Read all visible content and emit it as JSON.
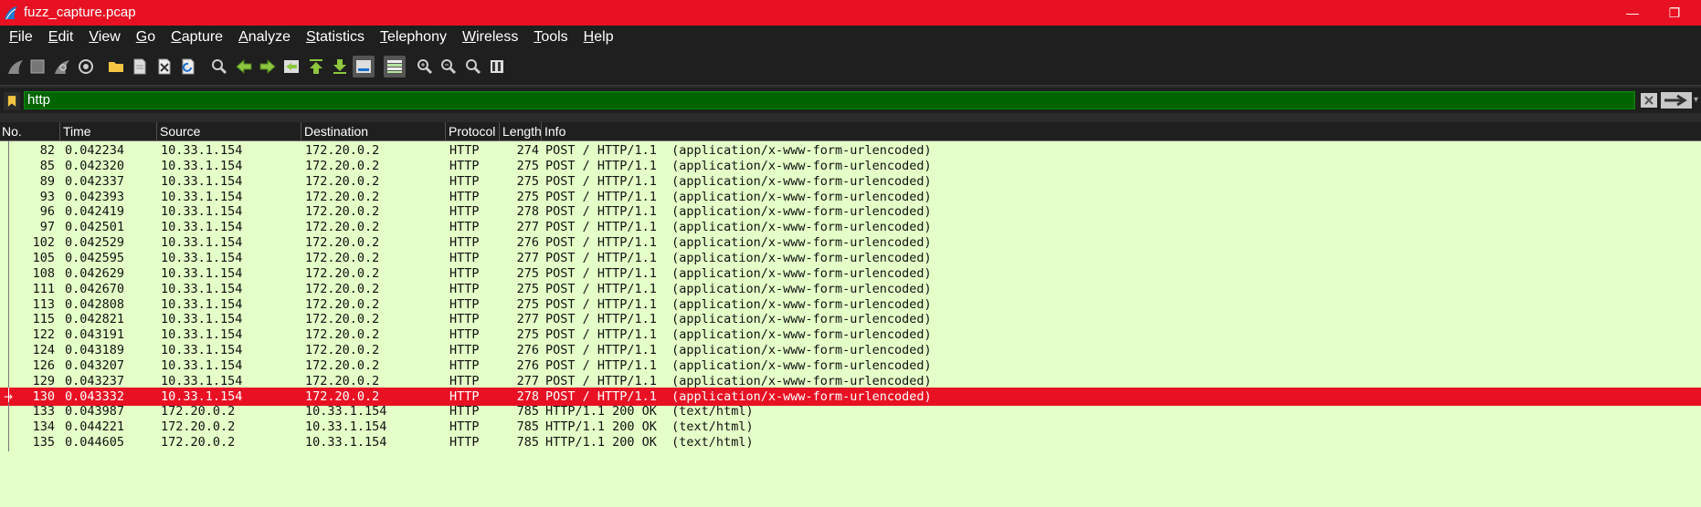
{
  "window": {
    "title": "fuzz_capture.pcap",
    "minimize_glyph": "—",
    "restore_glyph": "❐"
  },
  "menu": {
    "items": [
      {
        "label": "File",
        "key": "F",
        "rest": "ile"
      },
      {
        "label": "Edit",
        "key": "E",
        "rest": "dit"
      },
      {
        "label": "View",
        "key": "V",
        "rest": "iew"
      },
      {
        "label": "Go",
        "key": "G",
        "rest": "o"
      },
      {
        "label": "Capture",
        "key": "C",
        "rest": "apture"
      },
      {
        "label": "Analyze",
        "key": "A",
        "rest": "nalyze"
      },
      {
        "label": "Statistics",
        "key": "S",
        "rest": "tatistics"
      },
      {
        "label": "Telephony",
        "key": "T",
        "rest": "elephony"
      },
      {
        "label": "Wireless",
        "key": "W",
        "rest": "ireless"
      },
      {
        "label": "Tools",
        "key": "T",
        "rest": "ools"
      },
      {
        "label": "Help",
        "key": "H",
        "rest": "elp"
      }
    ]
  },
  "toolbar": {
    "icons": [
      "shark-fin-start-icon",
      "stop-square-icon",
      "restart-fin-icon",
      "capture-options-gear-icon",
      "open-folder-icon",
      "save-file-icon",
      "close-file-icon",
      "reload-icon",
      "find-packet-icon",
      "go-back-icon",
      "go-forward-icon",
      "go-to-packet-icon",
      "go-first-icon",
      "go-last-icon",
      "autoscroll-icon",
      "colorize-icon",
      "zoom-in-icon",
      "zoom-out-icon",
      "zoom-normal-icon",
      "resize-columns-icon"
    ]
  },
  "filter": {
    "value": "http",
    "bookmark_icon": "bookmark-icon",
    "clear_icon": "clear-filter-icon",
    "apply_icon": "apply-filter-arrow-icon",
    "background_color": "#006400"
  },
  "columns": [
    "No.",
    "Time",
    "Source",
    "Destination",
    "Protocol",
    "Length",
    "Info"
  ],
  "packets": [
    {
      "no": "82",
      "time": "0.042234",
      "src": "10.33.1.154",
      "dst": "172.20.0.2",
      "proto": "HTTP",
      "len": "274",
      "info": "POST / HTTP/1.1  (application/x-www-form-urlencoded)"
    },
    {
      "no": "85",
      "time": "0.042320",
      "src": "10.33.1.154",
      "dst": "172.20.0.2",
      "proto": "HTTP",
      "len": "275",
      "info": "POST / HTTP/1.1  (application/x-www-form-urlencoded)"
    },
    {
      "no": "89",
      "time": "0.042337",
      "src": "10.33.1.154",
      "dst": "172.20.0.2",
      "proto": "HTTP",
      "len": "275",
      "info": "POST / HTTP/1.1  (application/x-www-form-urlencoded)"
    },
    {
      "no": "93",
      "time": "0.042393",
      "src": "10.33.1.154",
      "dst": "172.20.0.2",
      "proto": "HTTP",
      "len": "275",
      "info": "POST / HTTP/1.1  (application/x-www-form-urlencoded)"
    },
    {
      "no": "96",
      "time": "0.042419",
      "src": "10.33.1.154",
      "dst": "172.20.0.2",
      "proto": "HTTP",
      "len": "278",
      "info": "POST / HTTP/1.1  (application/x-www-form-urlencoded)"
    },
    {
      "no": "97",
      "time": "0.042501",
      "src": "10.33.1.154",
      "dst": "172.20.0.2",
      "proto": "HTTP",
      "len": "277",
      "info": "POST / HTTP/1.1  (application/x-www-form-urlencoded)"
    },
    {
      "no": "102",
      "time": "0.042529",
      "src": "10.33.1.154",
      "dst": "172.20.0.2",
      "proto": "HTTP",
      "len": "276",
      "info": "POST / HTTP/1.1  (application/x-www-form-urlencoded)"
    },
    {
      "no": "105",
      "time": "0.042595",
      "src": "10.33.1.154",
      "dst": "172.20.0.2",
      "proto": "HTTP",
      "len": "277",
      "info": "POST / HTTP/1.1  (application/x-www-form-urlencoded)"
    },
    {
      "no": "108",
      "time": "0.042629",
      "src": "10.33.1.154",
      "dst": "172.20.0.2",
      "proto": "HTTP",
      "len": "275",
      "info": "POST / HTTP/1.1  (application/x-www-form-urlencoded)"
    },
    {
      "no": "111",
      "time": "0.042670",
      "src": "10.33.1.154",
      "dst": "172.20.0.2",
      "proto": "HTTP",
      "len": "275",
      "info": "POST / HTTP/1.1  (application/x-www-form-urlencoded)"
    },
    {
      "no": "113",
      "time": "0.042808",
      "src": "10.33.1.154",
      "dst": "172.20.0.2",
      "proto": "HTTP",
      "len": "275",
      "info": "POST / HTTP/1.1  (application/x-www-form-urlencoded)"
    },
    {
      "no": "115",
      "time": "0.042821",
      "src": "10.33.1.154",
      "dst": "172.20.0.2",
      "proto": "HTTP",
      "len": "277",
      "info": "POST / HTTP/1.1  (application/x-www-form-urlencoded)"
    },
    {
      "no": "122",
      "time": "0.043191",
      "src": "10.33.1.154",
      "dst": "172.20.0.2",
      "proto": "HTTP",
      "len": "275",
      "info": "POST / HTTP/1.1  (application/x-www-form-urlencoded)"
    },
    {
      "no": "124",
      "time": "0.043189",
      "src": "10.33.1.154",
      "dst": "172.20.0.2",
      "proto": "HTTP",
      "len": "276",
      "info": "POST / HTTP/1.1  (application/x-www-form-urlencoded)"
    },
    {
      "no": "126",
      "time": "0.043207",
      "src": "10.33.1.154",
      "dst": "172.20.0.2",
      "proto": "HTTP",
      "len": "276",
      "info": "POST / HTTP/1.1  (application/x-www-form-urlencoded)"
    },
    {
      "no": "129",
      "time": "0.043237",
      "src": "10.33.1.154",
      "dst": "172.20.0.2",
      "proto": "HTTP",
      "len": "277",
      "info": "POST / HTTP/1.1  (application/x-www-form-urlencoded)"
    },
    {
      "no": "130",
      "time": "0.043332",
      "src": "10.33.1.154",
      "dst": "172.20.0.2",
      "proto": "HTTP",
      "len": "278",
      "info": "POST / HTTP/1.1  (application/x-www-form-urlencoded)",
      "selected": true
    },
    {
      "no": "133",
      "time": "0.043987",
      "src": "172.20.0.2",
      "dst": "10.33.1.154",
      "proto": "HTTP",
      "len": "785",
      "info": "HTTP/1.1 200 OK  (text/html)"
    },
    {
      "no": "134",
      "time": "0.044221",
      "src": "172.20.0.2",
      "dst": "10.33.1.154",
      "proto": "HTTP",
      "len": "785",
      "info": "HTTP/1.1 200 OK  (text/html)"
    },
    {
      "no": "135",
      "time": "0.044605",
      "src": "172.20.0.2",
      "dst": "10.33.1.154",
      "proto": "HTTP",
      "len": "785",
      "info": "HTTP/1.1 200 OK  (text/html)"
    }
  ],
  "colors": {
    "titlebar": "#e81123",
    "row_background": "#e4ffc7",
    "selected_row": "#e81123",
    "filter_valid": "#006400"
  }
}
